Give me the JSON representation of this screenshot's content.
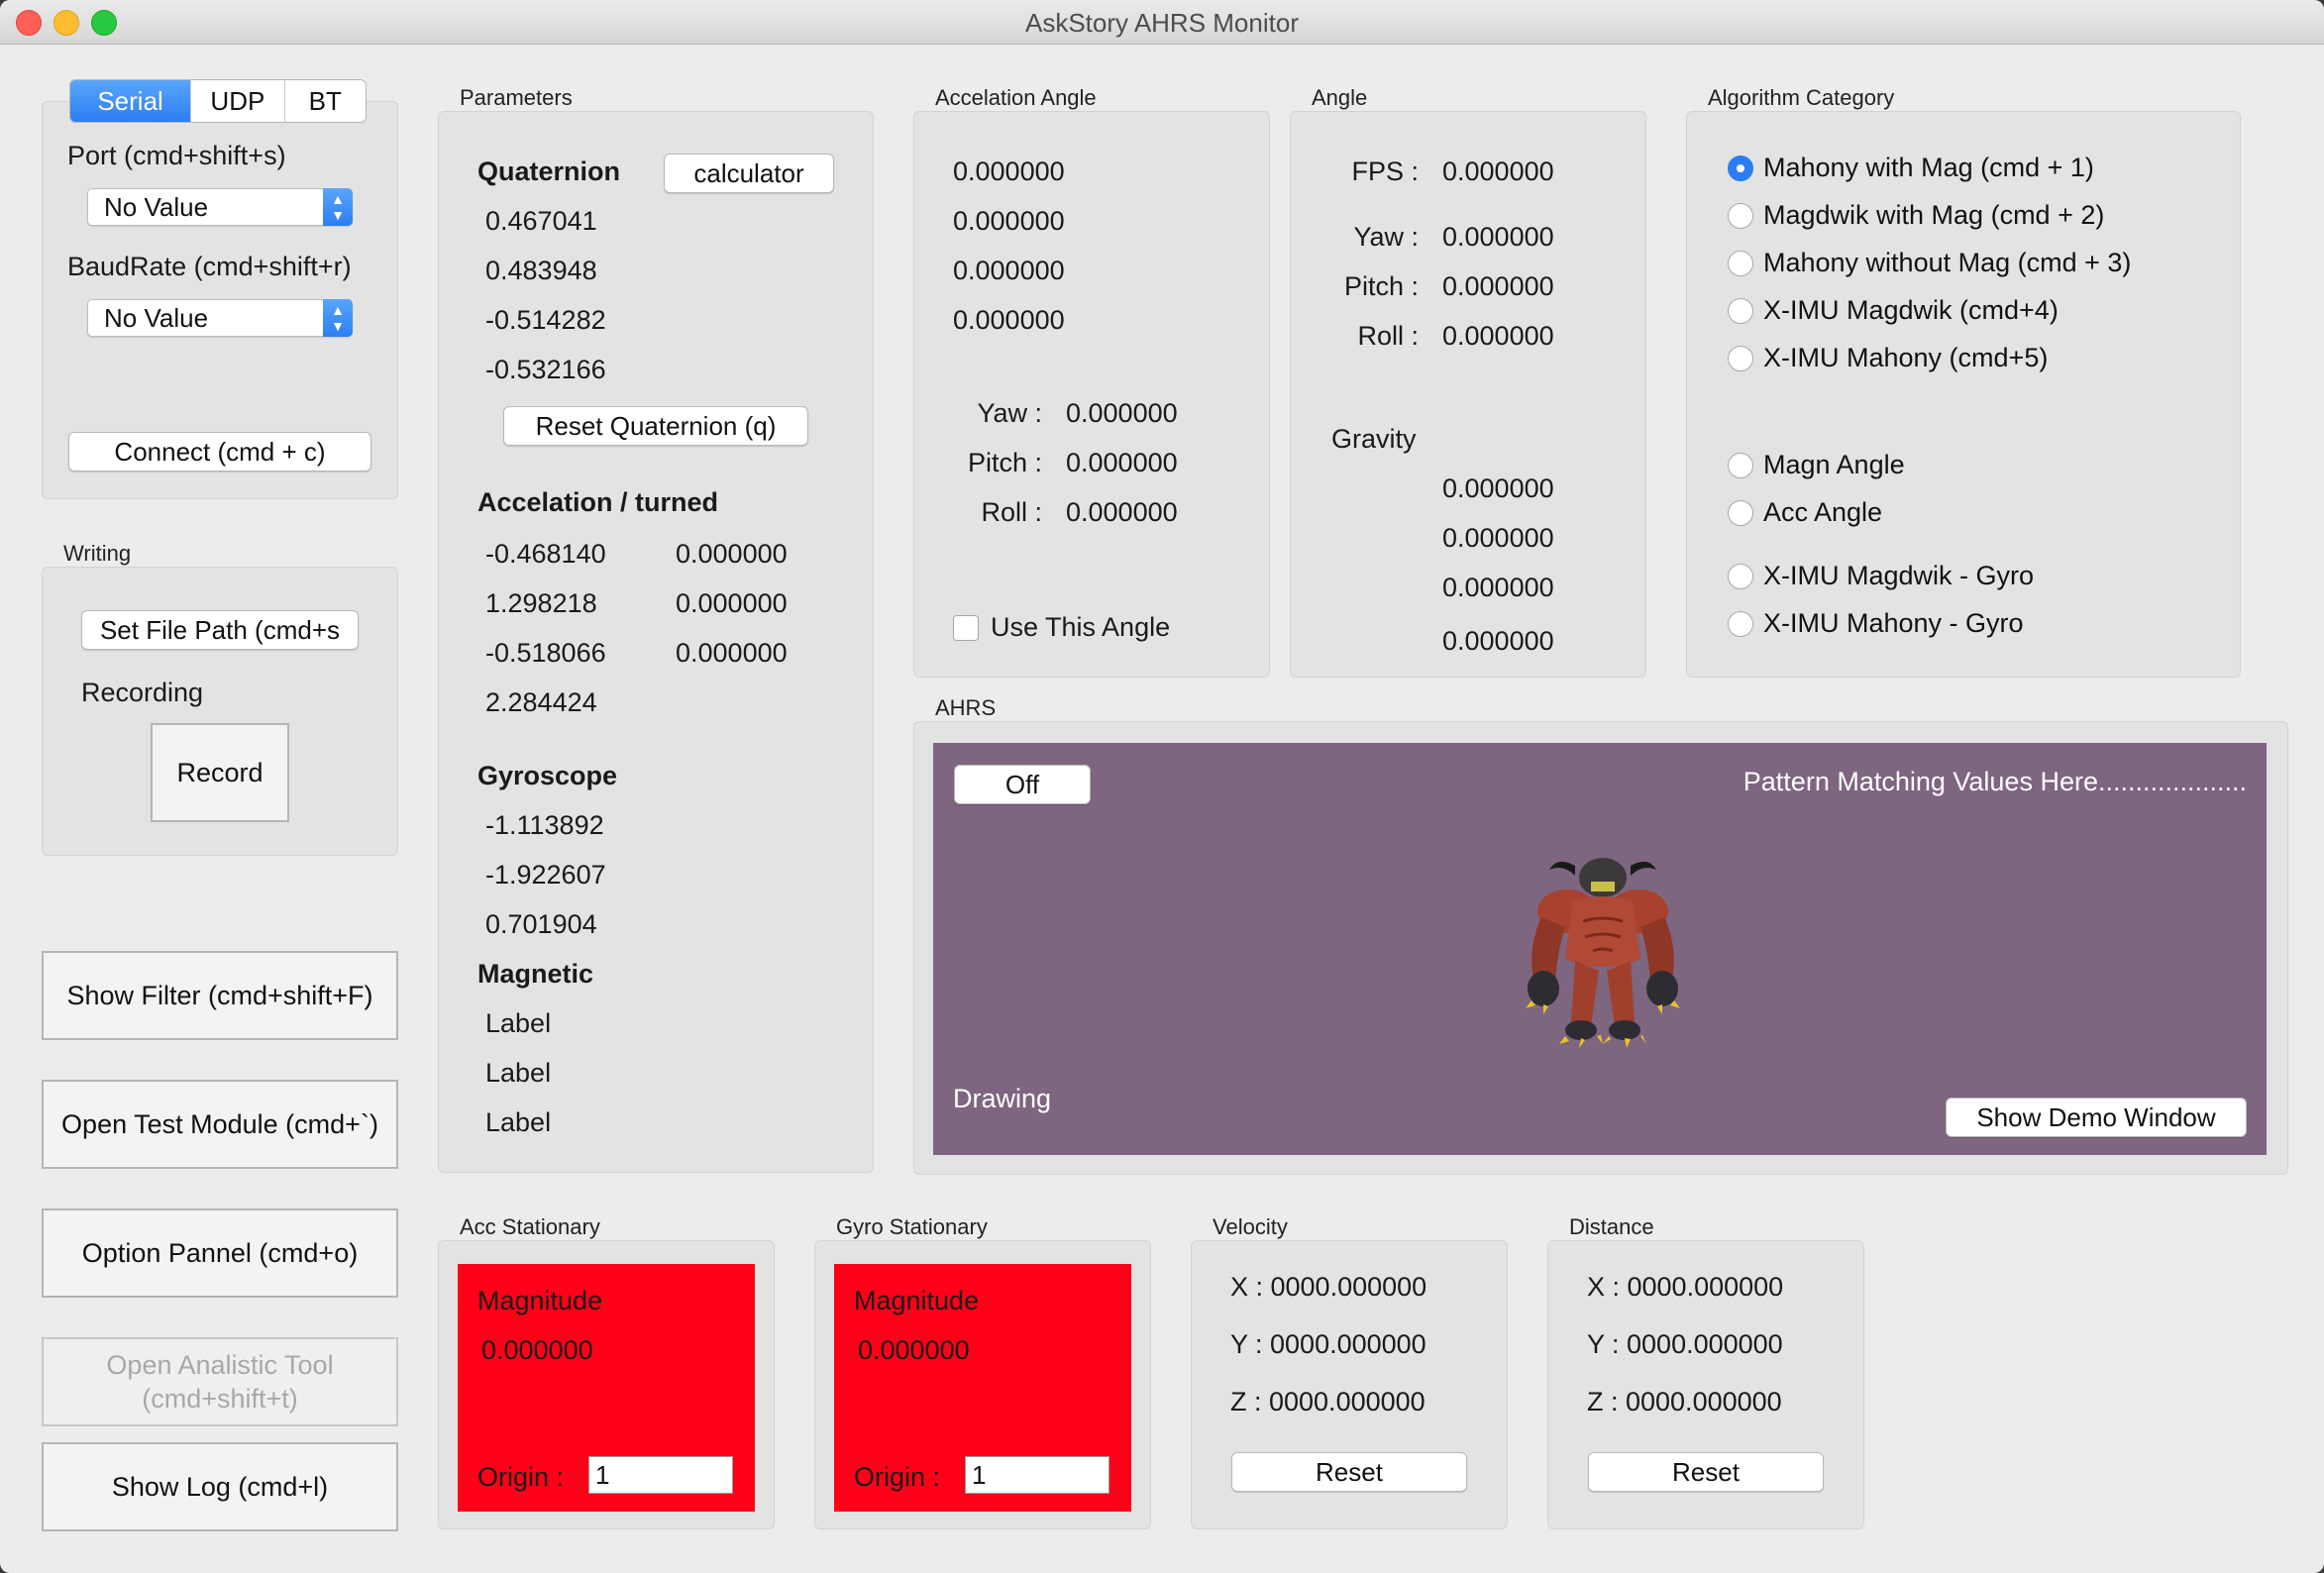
{
  "window": {
    "title": "AskStory AHRS Monitor"
  },
  "connection": {
    "tabs": [
      "Serial",
      "UDP",
      "BT"
    ],
    "active_tab": "Serial",
    "port_label": "Port (cmd+shift+s)",
    "port_value": "No Value",
    "baud_label": "BaudRate (cmd+shift+r)",
    "baud_value": "No Value",
    "connect_button": "Connect (cmd + c)"
  },
  "writing": {
    "title": "Writing",
    "set_path_button": "Set File Path (cmd+s",
    "recording_label": "Recording",
    "record_button": "Record"
  },
  "side_buttons": {
    "show_filter": "Show Filter (cmd+shift+F)",
    "open_test": "Open Test Module (cmd+`)",
    "option_panel": "Option Pannel (cmd+o)",
    "analistic_line1": "Open Analistic Tool",
    "analistic_line2": "(cmd+shift+t)",
    "show_log": "Show Log (cmd+l)"
  },
  "parameters": {
    "title": "Parameters",
    "quaternion_label": "Quaternion",
    "calculator_button": "calculator",
    "quaternion": [
      "0.467041",
      "0.483948",
      "-0.514282",
      "-0.532166"
    ],
    "reset_quaternion_button": "Reset Quaternion (q)",
    "accel_label": "Accelation / turned",
    "accel_col1": [
      "-0.468140",
      "1.298218",
      "-0.518066",
      "2.284424"
    ],
    "accel_col2": [
      "0.000000",
      "0.000000",
      "0.000000"
    ],
    "gyro_label": "Gyroscope",
    "gyro": [
      "-1.113892",
      "-1.922607",
      "0.701904"
    ],
    "magnetic_label": "Magnetic",
    "magnetic": [
      "Label",
      "Label",
      "Label"
    ]
  },
  "accel_angle": {
    "title": "Accelation Angle",
    "values": [
      "0.000000",
      "0.000000",
      "0.000000",
      "0.000000"
    ],
    "yaw_label": "Yaw :",
    "yaw": "0.000000",
    "pitch_label": "Pitch :",
    "pitch": "0.000000",
    "roll_label": "Roll :",
    "roll": "0.000000",
    "use_angle_label": "Use This Angle"
  },
  "angle": {
    "title": "Angle",
    "fps_label": "FPS :",
    "fps": "0.000000",
    "yaw_label": "Yaw :",
    "yaw": "0.000000",
    "pitch_label": "Pitch :",
    "pitch": "0.000000",
    "roll_label": "Roll :",
    "roll": "0.000000",
    "gravity_label": "Gravity",
    "gravity": [
      "0.000000",
      "0.000000",
      "0.000000",
      "0.000000"
    ]
  },
  "algorithm": {
    "title": "Algorithm Category",
    "options": [
      "Mahony with Mag (cmd + 1)",
      "Magdwik with Mag (cmd + 2)",
      "Mahony without Mag (cmd + 3)",
      "X-IMU Magdwik (cmd+4)",
      "X-IMU Mahony (cmd+5)",
      "Magn Angle",
      "Acc Angle",
      "X-IMU Magdwik - Gyro",
      "X-IMU Mahony - Gyro"
    ],
    "selected": "Mahony with Mag (cmd + 1)"
  },
  "ahrs": {
    "title": "AHRS",
    "toggle_button": "Off",
    "pattern_text": "Pattern Matching Values Here....................",
    "drawing_label": "Drawing",
    "demo_button": "Show Demo Window",
    "background_color": "#7e6580"
  },
  "acc_stationary": {
    "title": "Acc Stationary",
    "magnitude_label": "Magnitude",
    "magnitude": "0.000000",
    "origin_label": "Origin :",
    "origin_value": "1",
    "color": "#ff0019"
  },
  "gyro_stationary": {
    "title": "Gyro Stationary",
    "magnitude_label": "Magnitude",
    "magnitude": "0.000000",
    "origin_label": "Origin :",
    "origin_value": "1",
    "color": "#ff0019"
  },
  "velocity": {
    "title": "Velocity",
    "x": "X : 0000.000000",
    "y": "Y : 0000.000000",
    "z": "Z : 0000.000000",
    "reset_button": "Reset"
  },
  "distance": {
    "title": "Distance",
    "x": "X : 0000.000000",
    "y": "Y : 0000.000000",
    "z": "Z : 0000.000000",
    "reset_button": "Reset"
  }
}
